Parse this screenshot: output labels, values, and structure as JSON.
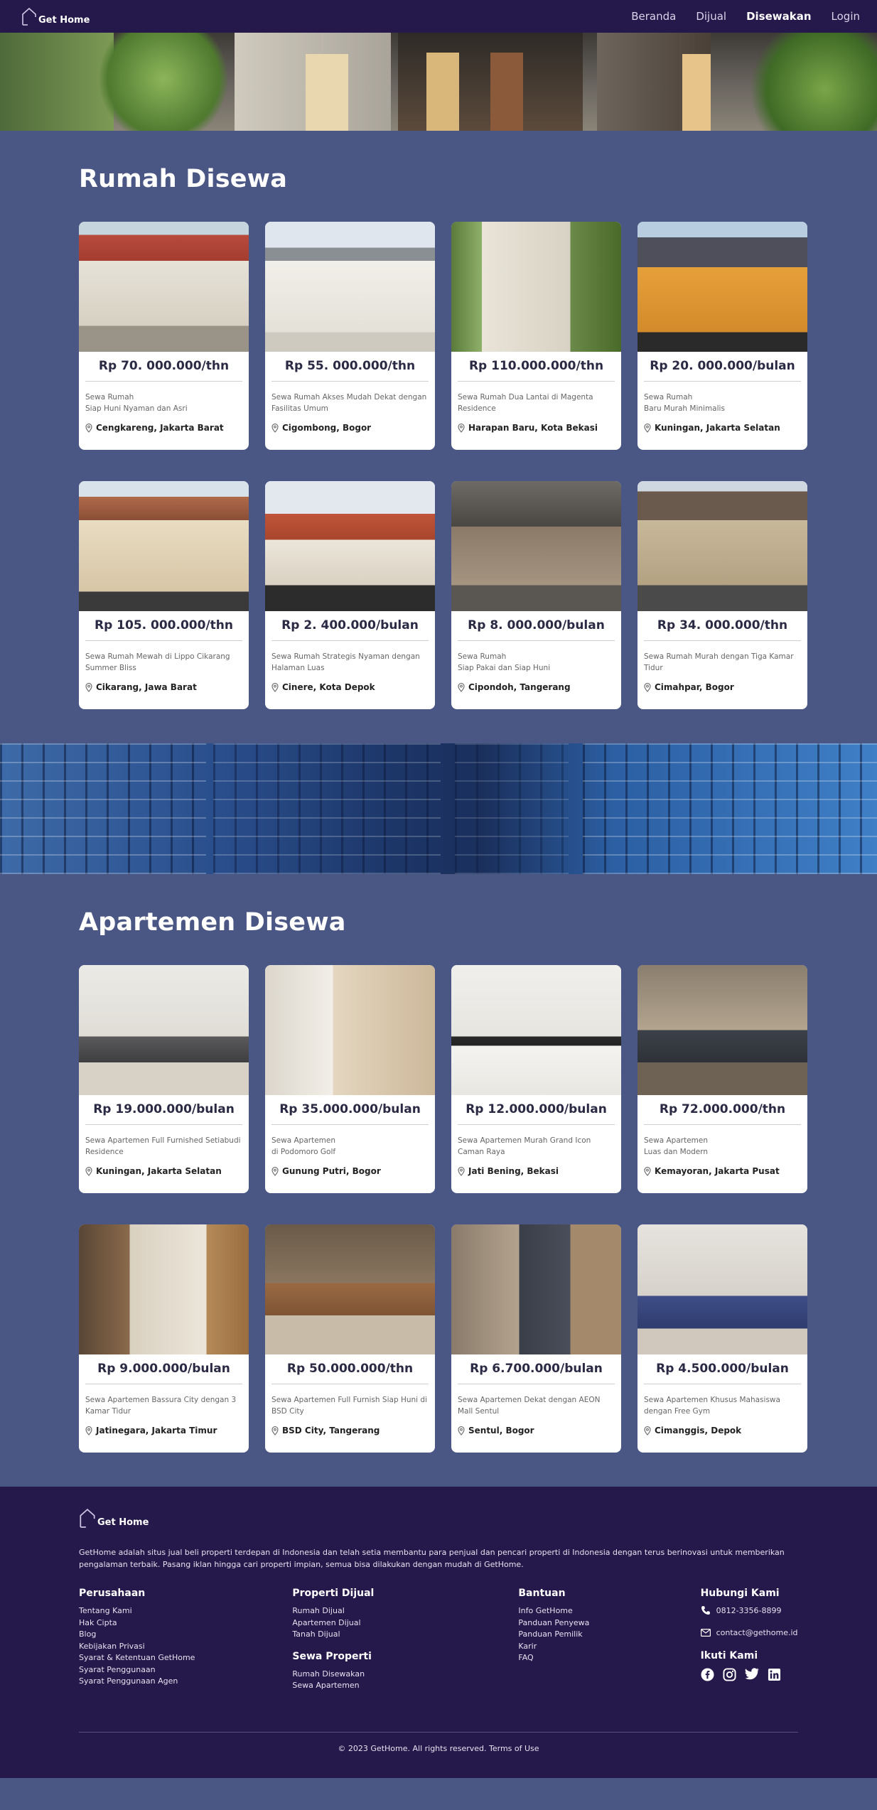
{
  "brand": "Get Home",
  "nav": {
    "items": [
      {
        "label": "Beranda"
      },
      {
        "label": "Dijual"
      },
      {
        "label": "Disewakan"
      },
      {
        "label": "Login"
      }
    ]
  },
  "houses": {
    "title": "Rumah Disewa",
    "cards": [
      {
        "price": "Rp 70. 000.000/thn",
        "desc": "Sewa Rumah\nSiap Huni Nyaman dan Asri",
        "location": "Cengkareng, Jakarta Barat"
      },
      {
        "price": "Rp 55. 000.000/thn",
        "desc": "Sewa Rumah Akses Mudah Dekat dengan Fasilitas Umum",
        "location": "Cigombong, Bogor"
      },
      {
        "price": "Rp 110.000.000/thn",
        "desc": "Sewa Rumah Dua Lantai di Magenta Residence",
        "location": "Harapan Baru, Kota Bekasi"
      },
      {
        "price": "Rp 20. 000.000/bulan",
        "desc": "Sewa Rumah\nBaru Murah Minimalis",
        "location": "Kuningan, Jakarta Selatan"
      },
      {
        "price": "Rp 105. 000.000/thn",
        "desc": "Sewa Rumah Mewah di Lippo Cikarang Summer Bliss",
        "location": "Cikarang, Jawa Barat"
      },
      {
        "price": "Rp 2. 400.000/bulan",
        "desc": "Sewa Rumah Strategis Nyaman dengan Halaman Luas",
        "location": "Cinere, Kota Depok"
      },
      {
        "price": "Rp 8. 000.000/bulan",
        "desc": "Sewa Rumah\nSiap Pakai dan Siap Huni",
        "location": "Cipondoh, Tangerang"
      },
      {
        "price": "Rp 34. 000.000/thn",
        "desc": "Sewa Rumah Murah dengan Tiga Kamar Tidur",
        "location": "Cimahpar, Bogor"
      }
    ]
  },
  "apartments": {
    "title": "Apartemen Disewa",
    "cards": [
      {
        "price": "Rp 19.000.000/bulan",
        "desc": "Sewa Apartemen Full Furnished Setiabudi Residence",
        "location": "Kuningan, Jakarta Selatan"
      },
      {
        "price": "Rp 35.000.000/bulan",
        "desc": "Sewa Apartemen\ndi Podomoro Golf",
        "location": "Gunung Putri, Bogor"
      },
      {
        "price": "Rp 12.000.000/bulan",
        "desc": "Sewa Apartemen Murah Grand Icon Caman Raya",
        "location": "Jati Bening, Bekasi"
      },
      {
        "price": "Rp 72.000.000/thn",
        "desc": "Sewa Apartemen\nLuas dan Modern",
        "location": "Kemayoran, Jakarta Pusat"
      },
      {
        "price": "Rp 9.000.000/bulan",
        "desc": "Sewa Apartemen Bassura City dengan 3 Kamar Tidur",
        "location": "Jatinegara, Jakarta Timur"
      },
      {
        "price": "Rp 50.000.000/thn",
        "desc": "Sewa Apartemen Full Furnish Siap Huni di BSD City",
        "location": "BSD City, Tangerang"
      },
      {
        "price": "Rp 6.700.000/bulan",
        "desc": "Sewa Apartemen Dekat dengan AEON Mall Sentul",
        "location": "Sentul, Bogor"
      },
      {
        "price": "Rp 4.500.000/bulan",
        "desc": "Sewa Apartemen Khusus Mahasiswa dengan Free Gym",
        "location": "Cimanggis, Depok"
      }
    ]
  },
  "footer": {
    "brand": "Get Home",
    "about": "GetHome adalah situs jual beli properti terdepan di Indonesia dan telah setia membantu para penjual dan pencari properti di Indonesia dengan terus berinovasi untuk memberikan pengalaman terbaik. Pasang iklan hingga cari properti impian, semua bisa dilakukan dengan mudah di GetHome.",
    "perusahaan": {
      "title": "Perusahaan",
      "links": [
        "Tentang Kami",
        "Hak Cipta",
        "Blog",
        "Kebijakan Privasi",
        "Syarat & Ketentuan GetHome",
        "Syarat Penggunaan",
        "Syarat Penggunaan Agen"
      ]
    },
    "dijual": {
      "title": "Properti Dijual",
      "links": [
        "Rumah Dijual",
        "Apartemen Dijual",
        "Tanah Dijual"
      ]
    },
    "sewa": {
      "title": "Sewa Properti",
      "links": [
        "Rumah Disewakan",
        "Sewa Apartemen"
      ]
    },
    "bantuan": {
      "title": "Bantuan",
      "links": [
        "Info GetHome",
        "Panduan Penyewa",
        "Panduan Pemilik",
        "Karir",
        "FAQ"
      ]
    },
    "hubungi": {
      "title": "Hubungi Kami",
      "phone": "0812-3356-8899",
      "email": "contact@gethome.id"
    },
    "ikuti": {
      "title": "Ikuti Kami"
    },
    "copyright": "© 2023 GetHome. All rights reserved. Terms of Use"
  },
  "icons": {
    "location": "map-pin-icon",
    "phone": "phone-icon",
    "email": "mail-icon",
    "social": [
      "facebook-icon",
      "instagram-icon",
      "twitter-icon",
      "linkedin-icon"
    ]
  },
  "colors": {
    "nav_bg": "#25184a",
    "page_bg": "#4a5684",
    "card_bg": "#ffffff",
    "price_text": "#2a2a44"
  }
}
